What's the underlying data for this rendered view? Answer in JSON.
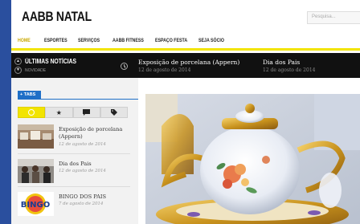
{
  "site": {
    "title": "AABB NATAL",
    "search_placeholder": "Pesquisa..."
  },
  "nav": {
    "items": [
      {
        "label": "HOME",
        "active": true
      },
      {
        "label": "ESPORTES"
      },
      {
        "label": "SERVIÇOS"
      },
      {
        "label": "AABB FITNESS"
      },
      {
        "label": "ESPAÇO FESTA"
      },
      {
        "label": "SEJA SÓCIO"
      }
    ]
  },
  "ticker": {
    "title": "ÚLTIMAS NOTÍCIAS",
    "subtitle": "NOVIDADE",
    "items": [
      {
        "headline": "Exposição de porcelana (Appern)",
        "date": "12 de agosto de 2014"
      },
      {
        "headline": "Dia dos Pais",
        "date": "12 de agosto de 2014"
      }
    ]
  },
  "sidebar": {
    "tabs_label": "TABS",
    "tab_icons": [
      "clock-icon",
      "star-icon",
      "comment-icon",
      "tag-icon"
    ],
    "items": [
      {
        "title": "Exposição de porcelana (Appern)",
        "date": "12 de agosto de 2014"
      },
      {
        "title": "Dia dos Pais",
        "date": "12 de agosto de 2014"
      },
      {
        "title": "BINGO DOS PAIS",
        "date": "7 de agosto de 2014",
        "thumb_text": "BINGO"
      }
    ]
  },
  "colors": {
    "accent": "#f2e400",
    "brand_blue": "#1f6fc7",
    "background": "#2a4f9e"
  }
}
